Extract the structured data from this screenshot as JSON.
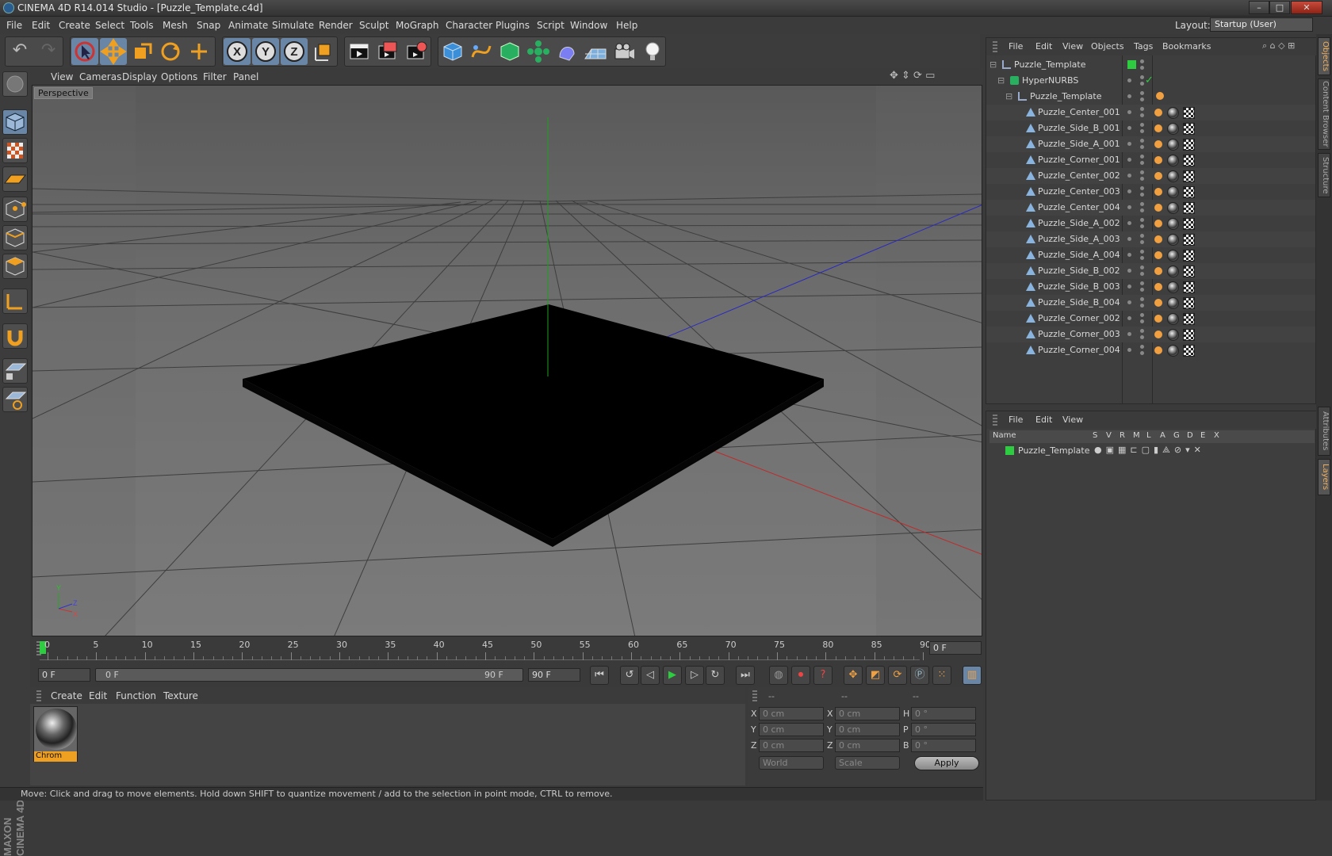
{
  "title": "CINEMA 4D R14.014 Studio - [Puzzle_Template.c4d]",
  "window_controls": [
    "–",
    "□",
    "✕"
  ],
  "menu": [
    "File",
    "Edit",
    "Create",
    "Select",
    "Tools",
    "Mesh",
    "Snap",
    "Animate",
    "Simulate",
    "Render",
    "Sculpt",
    "MoGraph",
    "Character",
    "Plugins",
    "Script",
    "Window",
    "Help"
  ],
  "layout": {
    "label": "Layout:",
    "value": "Startup (User)"
  },
  "toolbar_axes": [
    "X",
    "Y",
    "Z"
  ],
  "viewport": {
    "menu": [
      "View",
      "Cameras",
      "Display",
      "Options",
      "Filter",
      "Panel"
    ],
    "label": "Perspective",
    "axis_labels": {
      "y": "Y",
      "z": "Z",
      "x": "X"
    }
  },
  "timeline": {
    "ticks": [
      "0",
      "5",
      "10",
      "15",
      "20",
      "25",
      "30",
      "35",
      "40",
      "45",
      "50",
      "55",
      "60",
      "65",
      "70",
      "75",
      "80",
      "85",
      "90"
    ],
    "current_frame": "0 F",
    "start": "0 F",
    "range_start": "0 F",
    "range_end": "90 F",
    "end": "90 F"
  },
  "material_menu": [
    "Create",
    "Edit",
    "Function",
    "Texture"
  ],
  "material": {
    "name": "Chrom"
  },
  "coords": {
    "headers": [
      "--",
      "--",
      "--"
    ],
    "rows": [
      {
        "a": "X",
        "av": "0 cm",
        "b": "X",
        "bv": "0 cm",
        "c": "H",
        "cv": "0 °"
      },
      {
        "a": "Y",
        "av": "0 cm",
        "b": "Y",
        "bv": "0 cm",
        "c": "P",
        "cv": "0 °"
      },
      {
        "a": "Z",
        "av": "0 cm",
        "b": "Z",
        "bv": "0 cm",
        "c": "B",
        "cv": "0 °"
      }
    ],
    "mode1": "World",
    "mode2": "Scale",
    "apply": "Apply"
  },
  "status": "Move: Click and drag to move elements. Hold down SHIFT to quantize movement / add to the selection in point mode, CTRL to remove.",
  "logo": "MAXON CINEMA 4D",
  "object_manager": {
    "menu": [
      "File",
      "Edit",
      "View",
      "Objects",
      "Tags",
      "Bookmarks"
    ],
    "tree": [
      {
        "name": "Puzzle_Template",
        "depth": 0,
        "kind": "null"
      },
      {
        "name": "HyperNURBS",
        "depth": 1,
        "kind": "nurbs"
      },
      {
        "name": "Puzzle_Template",
        "depth": 2,
        "kind": "null"
      }
    ],
    "objects": [
      "Puzzle_Center_001",
      "Puzzle_Side_B_001",
      "Puzzle_Side_A_001",
      "Puzzle_Corner_001",
      "Puzzle_Center_002",
      "Puzzle_Center_003",
      "Puzzle_Center_004",
      "Puzzle_Side_A_002",
      "Puzzle_Side_A_003",
      "Puzzle_Side_A_004",
      "Puzzle_Side_B_002",
      "Puzzle_Side_B_003",
      "Puzzle_Side_B_004",
      "Puzzle_Corner_002",
      "Puzzle_Corner_003",
      "Puzzle_Corner_004"
    ]
  },
  "layer_manager": {
    "menu": [
      "File",
      "Edit",
      "View"
    ],
    "columns": [
      "Name",
      "S",
      "V",
      "R",
      "M",
      "L",
      "A",
      "G",
      "D",
      "E",
      "X"
    ],
    "layer": "Puzzle_Template"
  },
  "side_tabs": [
    "Objects",
    "Content Browser",
    "Structure",
    "Attributes",
    "Layers"
  ],
  "colors": {
    "accent": "#f0a040",
    "green": "#2ecc40",
    "selected": "#6a86a6"
  }
}
